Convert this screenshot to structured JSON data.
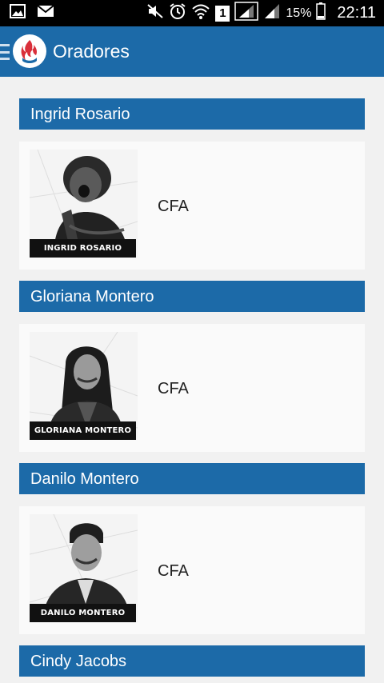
{
  "status_bar": {
    "battery": "15%",
    "time": "22:11",
    "sim_slot": "1"
  },
  "app_bar": {
    "title": "Oradores",
    "logo_icon": "app-logo-flame-icon",
    "menu_icon": "hamburger-menu-icon"
  },
  "speakers": [
    {
      "name": "Ingrid Rosario",
      "caption": "INGRID ROSARIO",
      "org": "CFA"
    },
    {
      "name": "Gloriana Montero",
      "caption": "GLORIANA MONTERO",
      "org": "CFA"
    },
    {
      "name": "Danilo Montero",
      "caption": "DANILO MONTERO",
      "org": "CFA"
    },
    {
      "name": "Cindy Jacobs"
    }
  ],
  "colors": {
    "primary": "#1c6aa8",
    "background": "#f1f1f1",
    "card": "#fafafa"
  }
}
